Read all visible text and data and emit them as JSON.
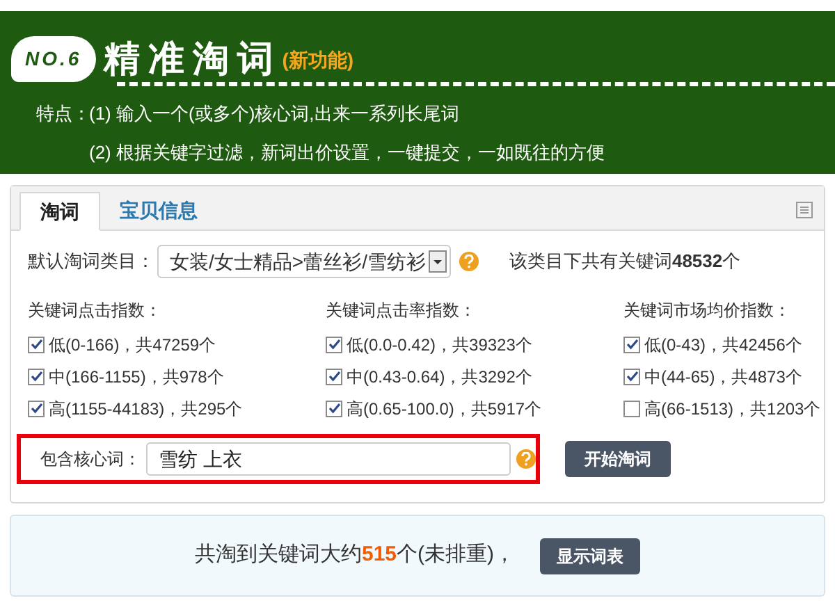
{
  "banner": {
    "badge": "NO.6",
    "title": "精准淘词",
    "tag": "(新功能)",
    "features": [
      {
        "label": "特点：",
        "text": "(1) 输入一个(或多个)核心词,出来一系列长尾词"
      },
      {
        "text": "(2) 根据关键字过滤，新词出价设置，一键提交，一如既往的方便"
      }
    ]
  },
  "tabs": [
    {
      "label": "淘词",
      "selected": true
    },
    {
      "label": "宝贝信息",
      "selected": false
    }
  ],
  "category": {
    "label": "默认淘词类目：",
    "value": "女装/女士精品>蕾丝衫/雪纺衫",
    "summary": "该类目下共有关键词**48532**个"
  },
  "filters": [
    {
      "title": "关键词点击指数：",
      "options": [
        {
          "label": "低(0-166)，共47259个",
          "checked": true
        },
        {
          "label": "中(166-1155)，共978个",
          "checked": true
        },
        {
          "label": "高(1155-44183)，共295个",
          "checked": true
        }
      ]
    },
    {
      "title": "关键词点击率指数：",
      "options": [
        {
          "label": "低(0.0-0.42)，共39323个",
          "checked": true
        },
        {
          "label": "中(0.43-0.64)，共3292个",
          "checked": true
        },
        {
          "label": "高(0.65-100.0)，共5917个",
          "checked": true
        }
      ]
    },
    {
      "title": "关键词市场均价指数：",
      "options": [
        {
          "label": "低(0-43)，共42456个",
          "checked": true
        },
        {
          "label": "中(44-65)，共4873个",
          "checked": true
        },
        {
          "label": "高(66-1513)，共1203个",
          "checked": false
        }
      ]
    }
  ],
  "core": {
    "label": "包含核心词：",
    "value": "雪纺 上衣",
    "button": "开始淘词"
  },
  "result": {
    "prefix": "共淘到关键词大约",
    "count": "515",
    "suffix": "个(未排重)，",
    "button": "显示词表"
  }
}
